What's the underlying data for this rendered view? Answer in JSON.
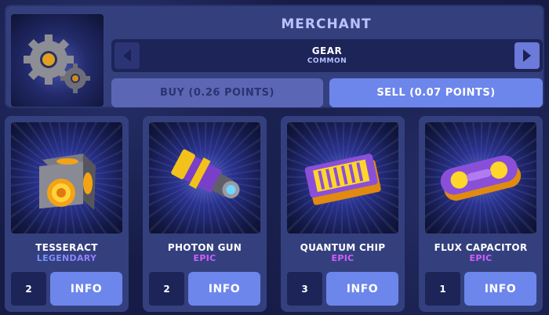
{
  "merchant": {
    "title": "MERCHANT",
    "item_icon": "gear-icon",
    "selected_item": "GEAR",
    "selected_rarity": "COMMON",
    "buy_label": "BUY (0.26 POINTS)",
    "sell_label": "SELL (0.07 POINTS)"
  },
  "inventory": [
    {
      "name": "TESSERACT",
      "rarity": "LEGENDARY",
      "count": "2",
      "info_label": "INFO",
      "icon": "tesseract-icon"
    },
    {
      "name": "PHOTON GUN",
      "rarity": "EPIC",
      "count": "2",
      "info_label": "INFO",
      "icon": "photon-gun-icon"
    },
    {
      "name": "QUANTUM CHIP",
      "rarity": "EPIC",
      "count": "3",
      "info_label": "INFO",
      "icon": "quantum-chip-icon"
    },
    {
      "name": "FLUX CAPACITOR",
      "rarity": "EPIC",
      "count": "1",
      "info_label": "INFO",
      "icon": "flux-capacitor-icon"
    }
  ],
  "colors": {
    "panel": "#34407e",
    "accent_button": "#6d86ec",
    "epic": "#d45cff",
    "legendary_start": "#5fa8ff",
    "legendary_end": "#b06bff"
  }
}
